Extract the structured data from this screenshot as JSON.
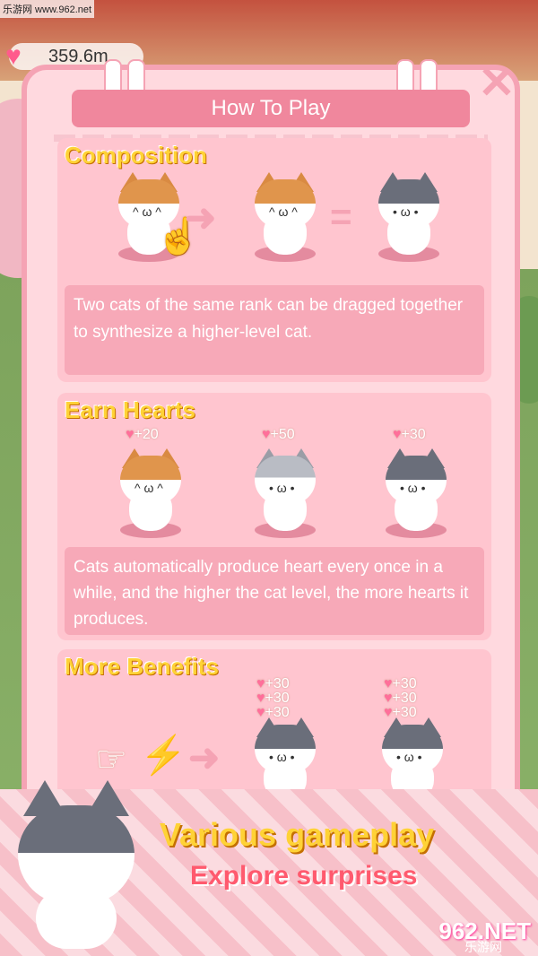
{
  "watermark": "乐游网 www.962.net",
  "hud": {
    "hearts": "359.6m"
  },
  "panel": {
    "title": "How To Play",
    "close_label": "✕"
  },
  "sections": {
    "composition": {
      "title": "Composition",
      "plus": "",
      "equals": "=",
      "description": "Two cats of the same rank can be dragged together to synthesize a higher-level cat."
    },
    "earn_hearts": {
      "title": "Earn Hearts",
      "gains": [
        "+20",
        "+50",
        "+30"
      ],
      "description": "Cats automatically produce heart every once in a while, and the higher the cat level, the more hearts it produces."
    },
    "more_benefits": {
      "title": "More Benefits",
      "gains_left": [
        "+30",
        "+30",
        "+30"
      ],
      "gains_right": [
        "+30",
        "+30",
        "+30"
      ]
    }
  },
  "banner": {
    "line1": "Various gameplay",
    "line2": "Explore surprises"
  },
  "logo": {
    "main": "962.NET",
    "sub": "乐游网"
  },
  "colors": {
    "panel": "#ffd9df",
    "accent": "#f0879d",
    "title_yellow": "#ffd236"
  }
}
